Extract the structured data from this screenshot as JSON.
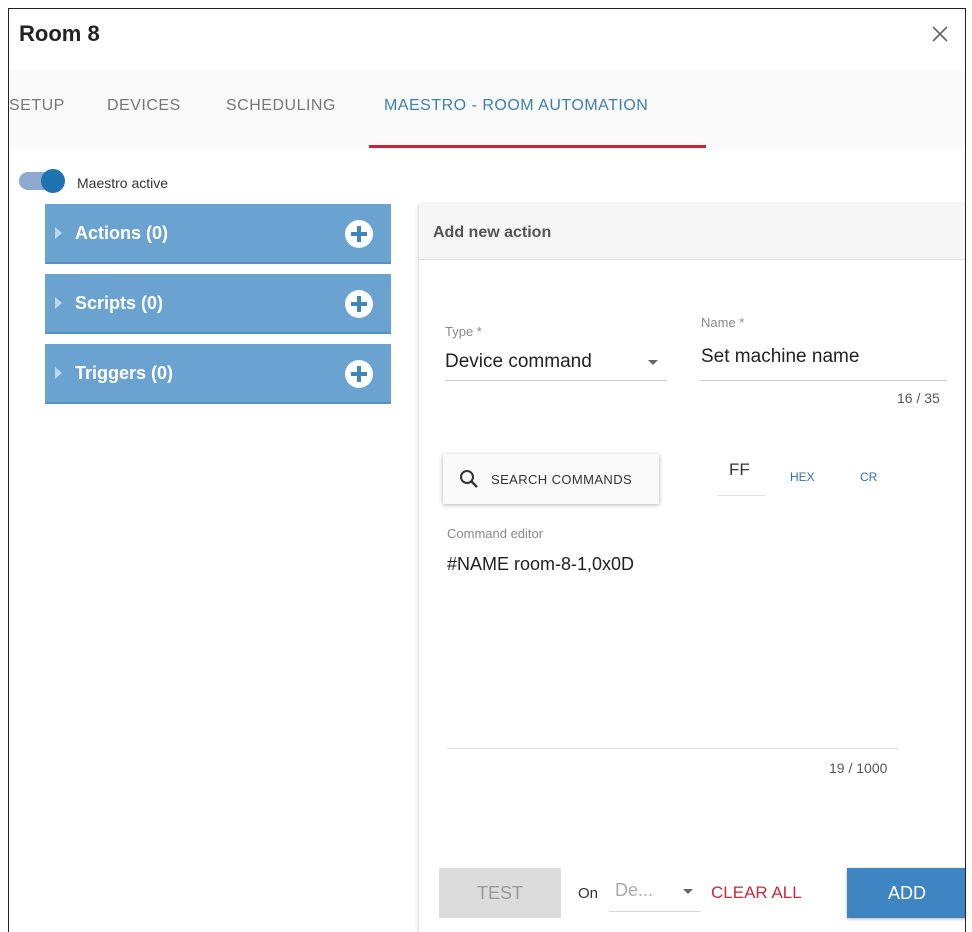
{
  "dialog": {
    "title": "Room 8"
  },
  "tabs": [
    {
      "label": "SETUP",
      "active": false
    },
    {
      "label": "DEVICES",
      "active": false
    },
    {
      "label": "SCHEDULING",
      "active": false
    },
    {
      "label": "MAESTRO - ROOM AUTOMATION",
      "active": true
    }
  ],
  "maestro": {
    "toggle_on": true,
    "label": "Maestro active"
  },
  "panels": [
    {
      "label": "Actions (0)"
    },
    {
      "label": "Scripts (0)"
    },
    {
      "label": "Triggers (0)"
    }
  ],
  "form": {
    "header": "Add new action",
    "type": {
      "label": "Type *",
      "value": "Device command"
    },
    "name": {
      "label": "Name *",
      "value": "Set machine name",
      "counter": "16 / 35"
    },
    "search_button": "SEARCH COMMANDS",
    "ff_value": "FF",
    "chips": {
      "hex": "HEX",
      "cr": "CR"
    },
    "command_editor": {
      "label": "Command editor",
      "value": "#NAME room-8-1,0x0D",
      "counter": "19 / 1000"
    },
    "footer": {
      "test": "TEST",
      "on_label": "On",
      "device_placeholder": "De...",
      "clear_all": "CLEAR ALL",
      "add": "ADD"
    }
  },
  "colors": {
    "accent_blue": "#3b7fb3",
    "tab_underline": "#cc1f3a",
    "panel_blue": "#6aa3cf",
    "clear_red": "#c42b3d",
    "add_button": "#3f85c2"
  },
  "icons": {
    "close": "close-icon",
    "search": "search-icon",
    "add": "plus-circle-icon",
    "expand": "caret-right-icon",
    "dropdown": "chevron-down-icon"
  }
}
